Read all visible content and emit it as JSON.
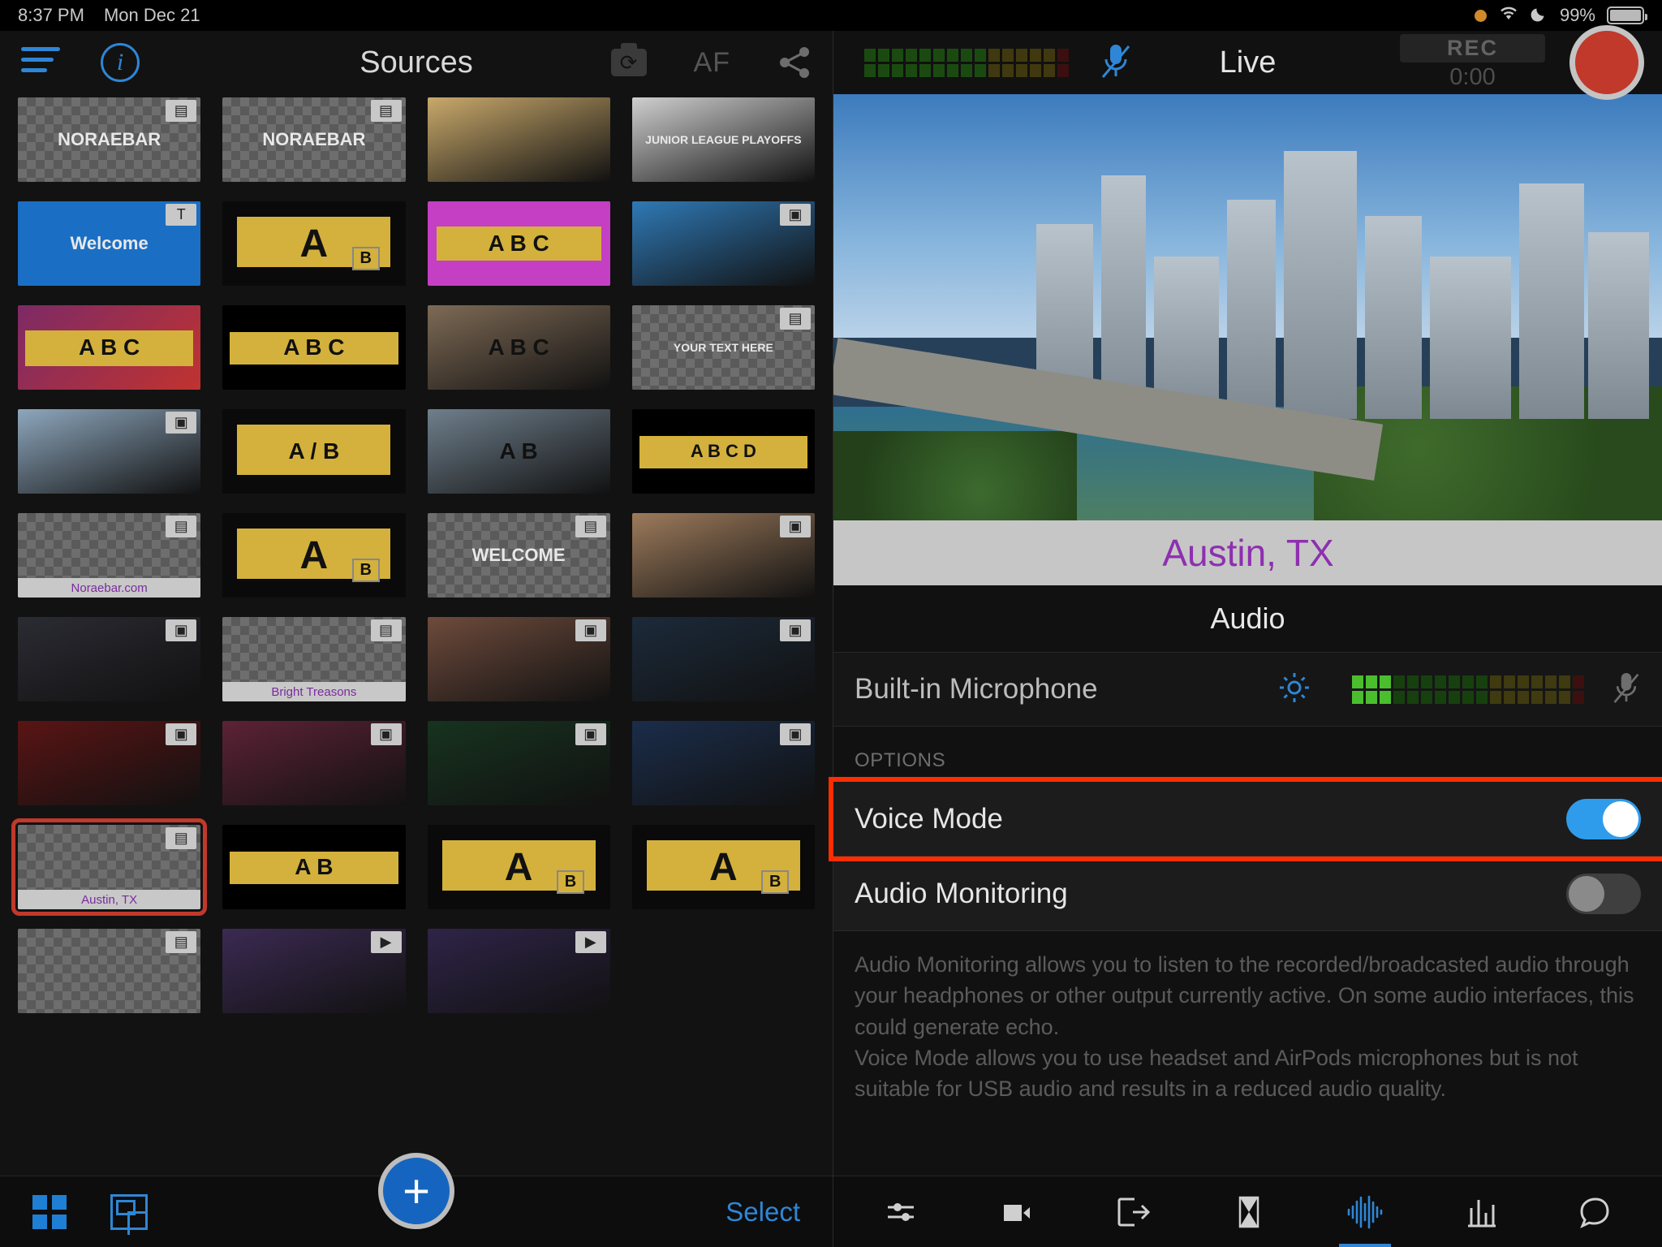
{
  "statusbar": {
    "time": "8:37 PM",
    "date": "Mon Dec 21",
    "battery_percent": "99%",
    "icons": [
      "orange-dot-icon",
      "wifi-icon",
      "moon-icon",
      "battery-icon"
    ]
  },
  "left": {
    "title": "Sources",
    "hamburger_label": "menu-icon",
    "info_label": "i",
    "af_label": "AF",
    "camera_flip_label": "camera-flip-icon",
    "share_label": "share-icon",
    "select_label": "Select",
    "add_label": "+",
    "grid_view_label": "grid-view-icon",
    "layout_view_label": "layout-view-icon",
    "thumbnails": [
      {
        "kind": "checker",
        "badge": "layers",
        "caption": "",
        "text": "NORAEBAR"
      },
      {
        "kind": "checker",
        "badge": "layers",
        "caption": "",
        "text": "NORAEBAR"
      },
      {
        "kind": "photo",
        "badge": "",
        "caption": "",
        "text": "",
        "color": "#c9a96b"
      },
      {
        "kind": "photo",
        "badge": "",
        "caption": "",
        "text": "JUNIOR LEAGUE PLAYOFFS",
        "color": "#cfcfcf"
      },
      {
        "kind": "solid",
        "badge": "T",
        "caption": "",
        "text": "Welcome",
        "color": "#1a6fc4"
      },
      {
        "kind": "yellow",
        "badge": "",
        "caption": "",
        "text": "A",
        "sub": "B"
      },
      {
        "kind": "magenta",
        "badge": "",
        "caption": "",
        "text": "A B C",
        "color": "#c43fc4"
      },
      {
        "kind": "photo",
        "badge": "image",
        "caption": "",
        "text": "",
        "color": "#2f79b5"
      },
      {
        "kind": "gradient",
        "badge": "",
        "caption": "",
        "text": "A B C",
        "color": "#8e2f5f"
      },
      {
        "kind": "black",
        "badge": "",
        "caption": "",
        "text": "A B C",
        "color": "#000000"
      },
      {
        "kind": "photo",
        "badge": "",
        "caption": "",
        "text": "A B C",
        "color": "#7e6a55"
      },
      {
        "kind": "checker",
        "badge": "layers",
        "caption": "",
        "text": "YOUR TEXT HERE"
      },
      {
        "kind": "photo",
        "badge": "image",
        "caption": "",
        "text": "",
        "color": "#8ea7bd"
      },
      {
        "kind": "yellow",
        "badge": "",
        "caption": "",
        "text": "A / B"
      },
      {
        "kind": "photo",
        "badge": "",
        "caption": "",
        "text": "A    B",
        "color": "#6f7f8c"
      },
      {
        "kind": "black",
        "badge": "",
        "caption": "",
        "text": "A B C D",
        "color": "#000000"
      },
      {
        "kind": "checker",
        "badge": "layers",
        "caption": "Noraebar.com",
        "text": ""
      },
      {
        "kind": "yellow",
        "badge": "",
        "caption": "",
        "text": "A",
        "sub": "B"
      },
      {
        "kind": "checker",
        "badge": "layers",
        "caption": "",
        "text": "WELCOME"
      },
      {
        "kind": "photo",
        "badge": "image",
        "caption": "",
        "text": "",
        "color": "#9d7b5c"
      },
      {
        "kind": "photo",
        "badge": "image",
        "caption": "",
        "text": "",
        "color": "#2b2b33"
      },
      {
        "kind": "checker",
        "badge": "layers",
        "caption": "Bright Treasons",
        "text": ""
      },
      {
        "kind": "photo",
        "badge": "image",
        "caption": "",
        "text": "",
        "color": "#6e4b3c"
      },
      {
        "kind": "photo",
        "badge": "image",
        "caption": "",
        "text": "",
        "color": "#1c2a3a"
      },
      {
        "kind": "photo",
        "badge": "image",
        "caption": "",
        "text": "",
        "color": "#5a1414"
      },
      {
        "kind": "photo",
        "badge": "image",
        "caption": "",
        "text": "",
        "color": "#5c2236"
      },
      {
        "kind": "photo",
        "badge": "image",
        "caption": "",
        "text": "",
        "color": "#17331f"
      },
      {
        "kind": "photo",
        "badge": "image",
        "caption": "",
        "text": "",
        "color": "#1b2d4a"
      },
      {
        "kind": "checker",
        "badge": "layers",
        "caption": "Austin, TX",
        "text": "",
        "selected": true
      },
      {
        "kind": "black",
        "badge": "",
        "caption": "",
        "text": "A   B",
        "color": "#000000"
      },
      {
        "kind": "yellow",
        "badge": "",
        "caption": "",
        "text": "A",
        "sub": "B"
      },
      {
        "kind": "yellow",
        "badge": "",
        "caption": "",
        "text": "A",
        "sub": "B"
      },
      {
        "kind": "checker",
        "badge": "layers",
        "caption": "",
        "text": ""
      },
      {
        "kind": "photo",
        "badge": "play",
        "caption": "",
        "text": "",
        "color": "#3b2a52"
      },
      {
        "kind": "photo",
        "badge": "play",
        "caption": "",
        "text": "",
        "color": "#2f2448"
      },
      {
        "kind": "empty",
        "badge": "",
        "caption": "",
        "text": ""
      }
    ]
  },
  "right": {
    "title": "Live",
    "rec_label": "REC",
    "rec_time": "0:00",
    "record_button_label": "record-button",
    "mic_muted_label": "mic-muted-icon",
    "preview": {
      "lower_third_text": "Austin, TX",
      "lower_third_color": "#8e2fb0"
    },
    "audio": {
      "section_title": "Audio",
      "device_name": "Built-in Microphone",
      "gear_label": "gear-icon",
      "mic_mute_label": "mic-muted-icon",
      "options_header": "OPTIONS",
      "rows": [
        {
          "label": "Voice Mode",
          "on": true,
          "highlighted": true
        },
        {
          "label": "Audio Monitoring",
          "on": false,
          "highlighted": false
        }
      ],
      "description": "Audio Monitoring allows you to listen to the recorded/broadcasted audio through your headphones or other output currently active. On some audio interfaces, this could generate echo.\nVoice Mode allows you to use headset and AirPods microphones but is not suitable for USB audio and results in a reduced audio quality."
    },
    "toolbar": [
      {
        "name": "sliders-icon",
        "active": false
      },
      {
        "name": "video-camera-icon",
        "active": false
      },
      {
        "name": "output-arrow-icon",
        "active": false
      },
      {
        "name": "transition-icon",
        "active": false
      },
      {
        "name": "audio-waveform-icon",
        "active": true
      },
      {
        "name": "bar-chart-icon",
        "active": false
      },
      {
        "name": "chat-bubble-icon",
        "active": false
      }
    ]
  },
  "colors": {
    "accent_blue": "#2f86d6",
    "highlight_red": "#ff2d00",
    "record_red": "#c0392b",
    "toggle_on": "#2f9ceb"
  }
}
